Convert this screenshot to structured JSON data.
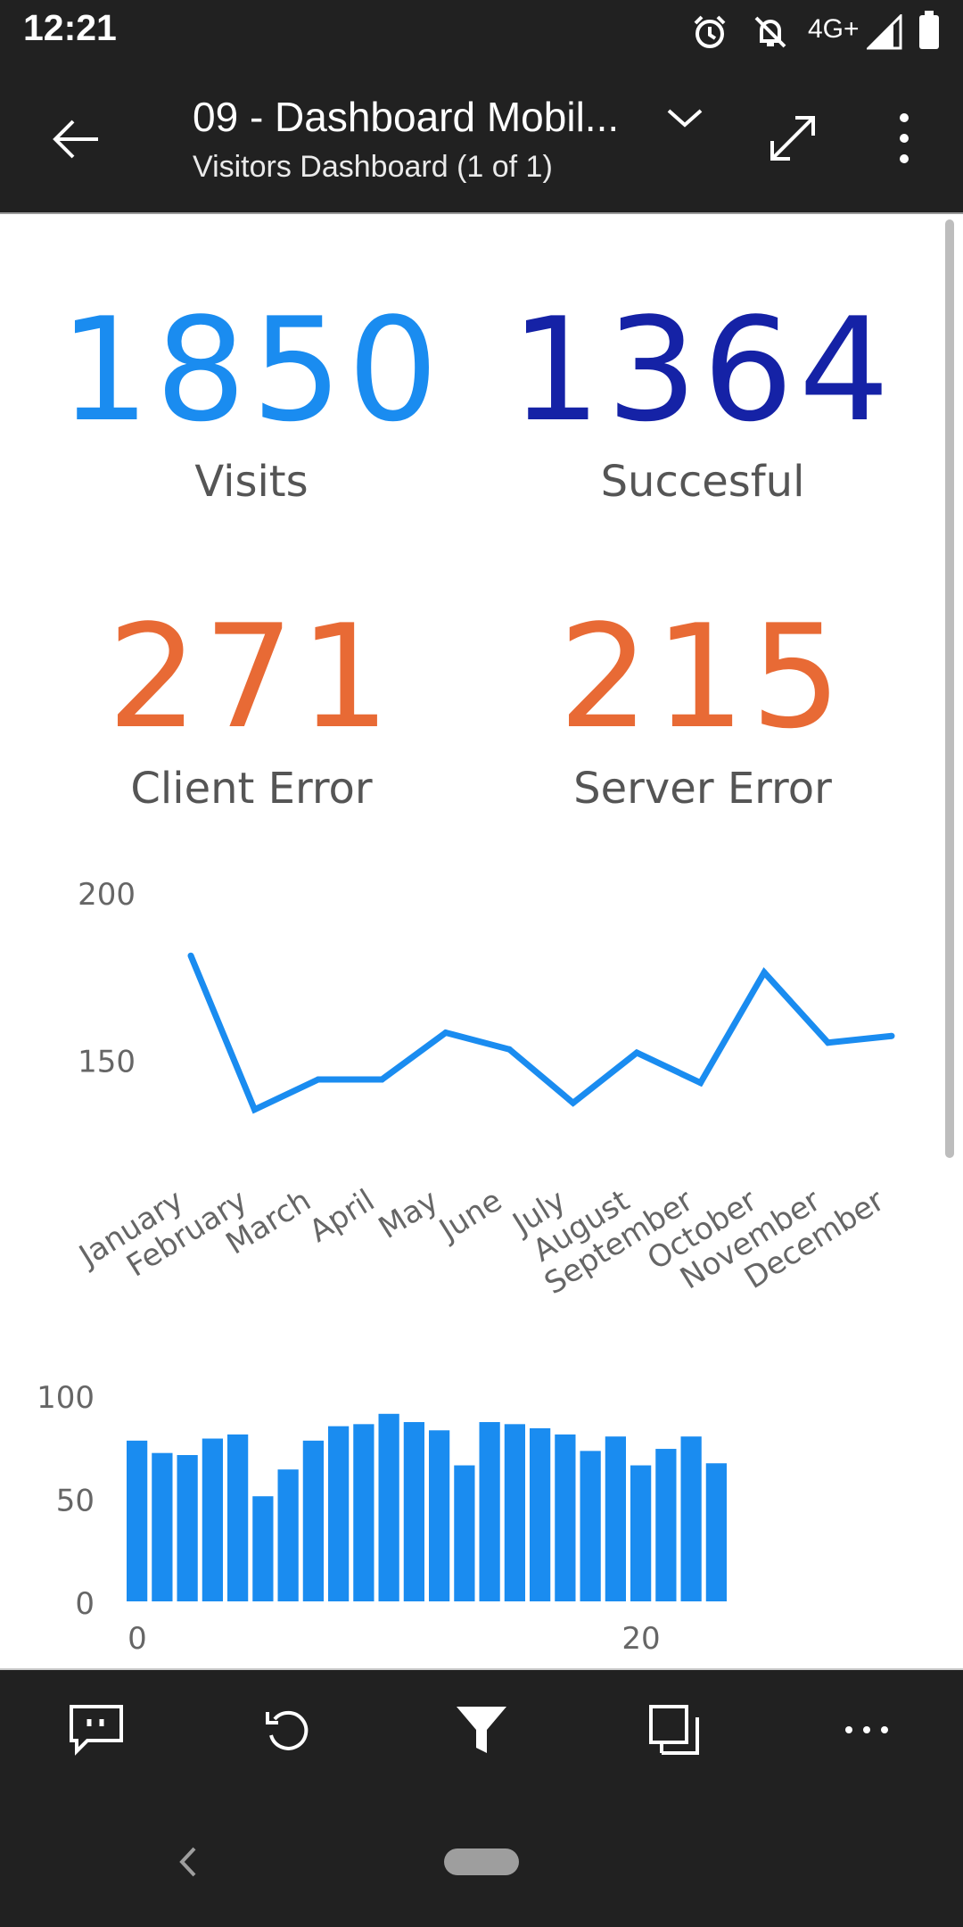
{
  "status_bar": {
    "time": "12:21",
    "network": "4G+"
  },
  "header": {
    "title": "09 - Dashboard Mobil...",
    "subtitle": "Visitors Dashboard (1 of 1)"
  },
  "kpis": [
    {
      "value": "1850",
      "label": "Visits",
      "color": "#1a8cf0"
    },
    {
      "value": "1364",
      "label": "Succesful",
      "color": "#1522a6"
    },
    {
      "value": "271",
      "label": "Client Error",
      "color": "#e86a35"
    },
    {
      "value": "215",
      "label": "Server Error",
      "color": "#e86a35"
    }
  ],
  "colors": {
    "accent": "#1a8cf0",
    "navy": "#1522a6",
    "orange": "#e86a35",
    "bar_bg": "#212121"
  },
  "chart_data": [
    {
      "type": "line",
      "categories": [
        "January",
        "February",
        "March",
        "April",
        "May",
        "June",
        "July",
        "August",
        "September",
        "October",
        "November",
        "December"
      ],
      "values": [
        181,
        135,
        144,
        144,
        158,
        153,
        137,
        152,
        143,
        176,
        155,
        157
      ],
      "yticks": [
        150,
        200
      ],
      "ylim": [
        120,
        200
      ],
      "grid": false,
      "color": "#1a8cf0"
    },
    {
      "type": "bar",
      "x": [
        0,
        1,
        2,
        3,
        4,
        5,
        6,
        7,
        8,
        9,
        10,
        11,
        12,
        13,
        14,
        15,
        16,
        17,
        18,
        19,
        20,
        21,
        22,
        23
      ],
      "values": [
        78,
        72,
        71,
        79,
        81,
        51,
        64,
        78,
        85,
        86,
        91,
        87,
        83,
        66,
        87,
        86,
        84,
        81,
        73,
        80,
        66,
        74,
        80,
        67
      ],
      "yticks": [
        0,
        50,
        100
      ],
      "xticks": [
        0,
        20
      ],
      "ylim": [
        0,
        100
      ],
      "grid": false,
      "color": "#1a8cf0"
    }
  ]
}
